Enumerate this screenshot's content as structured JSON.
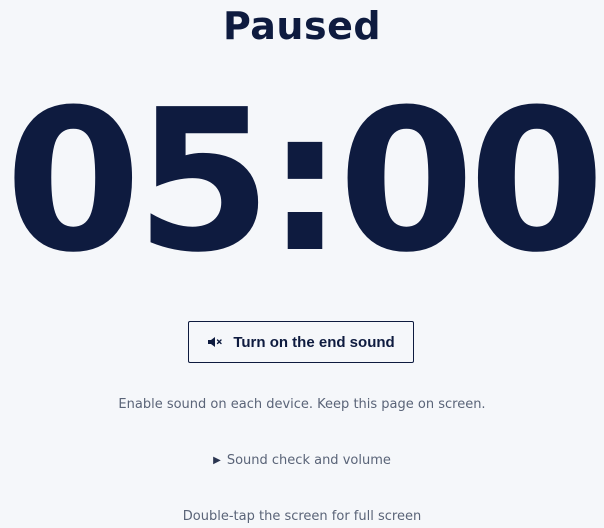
{
  "status": {
    "title": "Paused"
  },
  "timer": {
    "display": "05:00"
  },
  "sound_button": {
    "label": "Turn on the end sound",
    "icon": "speaker-muted-icon"
  },
  "hints": {
    "sound": "Enable sound on each device. Keep this page on screen.",
    "fullscreen": "Double-tap the screen for full screen"
  },
  "sound_check": {
    "label": "Sound check and volume",
    "icon": "triangle-right-icon"
  },
  "colors": {
    "background": "#f5f7fa",
    "text_primary": "#0e1b3f",
    "text_secondary": "#5a6478"
  }
}
